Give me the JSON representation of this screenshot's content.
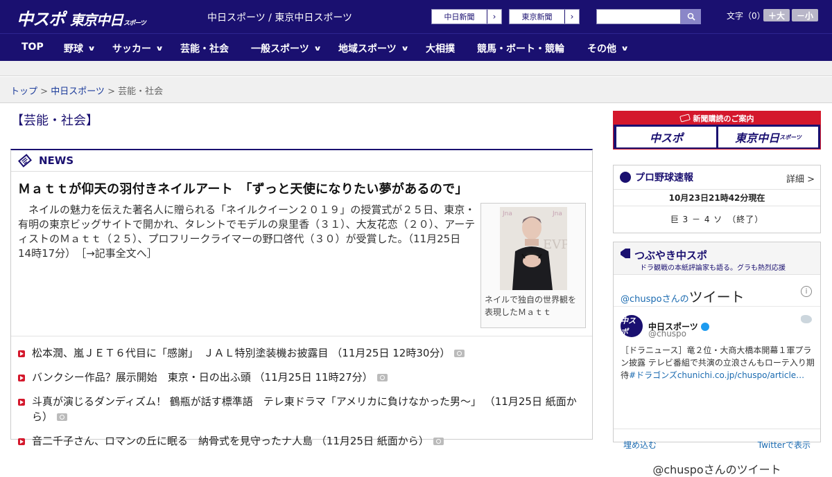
{
  "header": {
    "logo_chuspo": "中スポ",
    "logo_tokyo": "東京中日",
    "logo_tokyo_suffix": "スポーツ",
    "site_links": "中日スポーツ / 東京中日スポーツ",
    "chunichi_btn": "中日新聞",
    "tokyo_btn": "東京新聞",
    "search_placeholder": "",
    "fontsize_label": "文字（0）",
    "font_larger": "＋大",
    "font_smaller": "－小"
  },
  "nav": {
    "items": [
      {
        "label": "TOP"
      },
      {
        "label": "野球"
      },
      {
        "label": "サッカー"
      },
      {
        "label": "芸能・社会"
      },
      {
        "label": "一般スポーツ"
      },
      {
        "label": "地域スポーツ"
      },
      {
        "label": "大相撲"
      },
      {
        "label": "競馬・ボート・競輪"
      },
      {
        "label": "その他"
      }
    ]
  },
  "breadcrumb": {
    "top": "トップ",
    "sep1": " > ",
    "chuspo": "中日スポーツ",
    "sep2": " > ",
    "current": "芸能・社会"
  },
  "page_title": "【芸能・社会】",
  "news": {
    "label": "NEWS",
    "headline": "Ｍａｔｔが仰天の羽付きネイルアート　「ずっと天使になりたい夢があるので」",
    "lead": "ネイルの魅力を伝えた著名人に贈られる「ネイルクイーン２０１９」の授賞式が２５日、東京・有明の東京ビッグサイトで開かれ、タレントでモデルの泉里香（３１）、大友花恋（２０）、アーティストのＭａｔｔ（２５）、プロフリークライマーの野口啓代（３０）が受賞した。",
    "lead_meta": "（11月25日 14時17分）",
    "read_more": "［→記事全文へ］",
    "photo_caption": "ネイルで独自の世界観を表現したＭａｔｔ",
    "items": [
      {
        "text": "松本潤、嵐ＪＥＴ６代目に「感謝」　ＪＡＬ特別塗装機お披露目",
        "meta": "（11月25日 12時30分）"
      },
      {
        "text": "バンクシー作品？展示開始　東京・日の出ふ頭",
        "meta": "（11月25日 11時27分）"
      },
      {
        "text": "斗真が演じるダンディズム！ 鶴瓶が話す標準語　テレ東ドラマ「アメリカに負けなかった男～」",
        "meta": "（11月25日 紙面から）"
      },
      {
        "text": "音二千子さん、ロマンの丘に眠る　納骨式を見守ったナ人島",
        "meta": "（11月25日 紙面から）"
      }
    ]
  },
  "sidebar": {
    "subscribe_title": "新聞購読のご案内",
    "subscribe_btn1": "中スポ",
    "subscribe_btn2": "東京中日",
    "subscribe_btn2_suffix": "スポーツ",
    "baseball_title": "プロ野球速報",
    "baseball_detail": "詳細 >",
    "baseball_time": "10月23日21時42分現在",
    "baseball_score": "巨 3 － 4 ソ　（終了）",
    "tweets_title": "つぶやき中スポ",
    "tweets_sub": "ドラ観戦の本紙評論家も語る。グラも熱烈応援",
    "tweets_handle": "@chuspoさんの",
    "tweets_word": "ツイート",
    "tw_name": "中日スポーツ",
    "tw_at": "@chuspo",
    "tw_avatar": "中スポ",
    "tw_text": "［ドラニュース］竜２位・大商大橋本開幕１軍プラン披露 テレビ番組で共演の立浪さんもローテ入り期待",
    "tw_link": "#ドラゴンズchunichi.co.jp/chuspo/article…",
    "tw_embed": "埋め込む",
    "tw_view": "Twitterで表示",
    "tw_more": "@chuspoさんのツイート"
  },
  "colors": {
    "brand": "#1a1070",
    "accent_red": "#d4182c"
  }
}
